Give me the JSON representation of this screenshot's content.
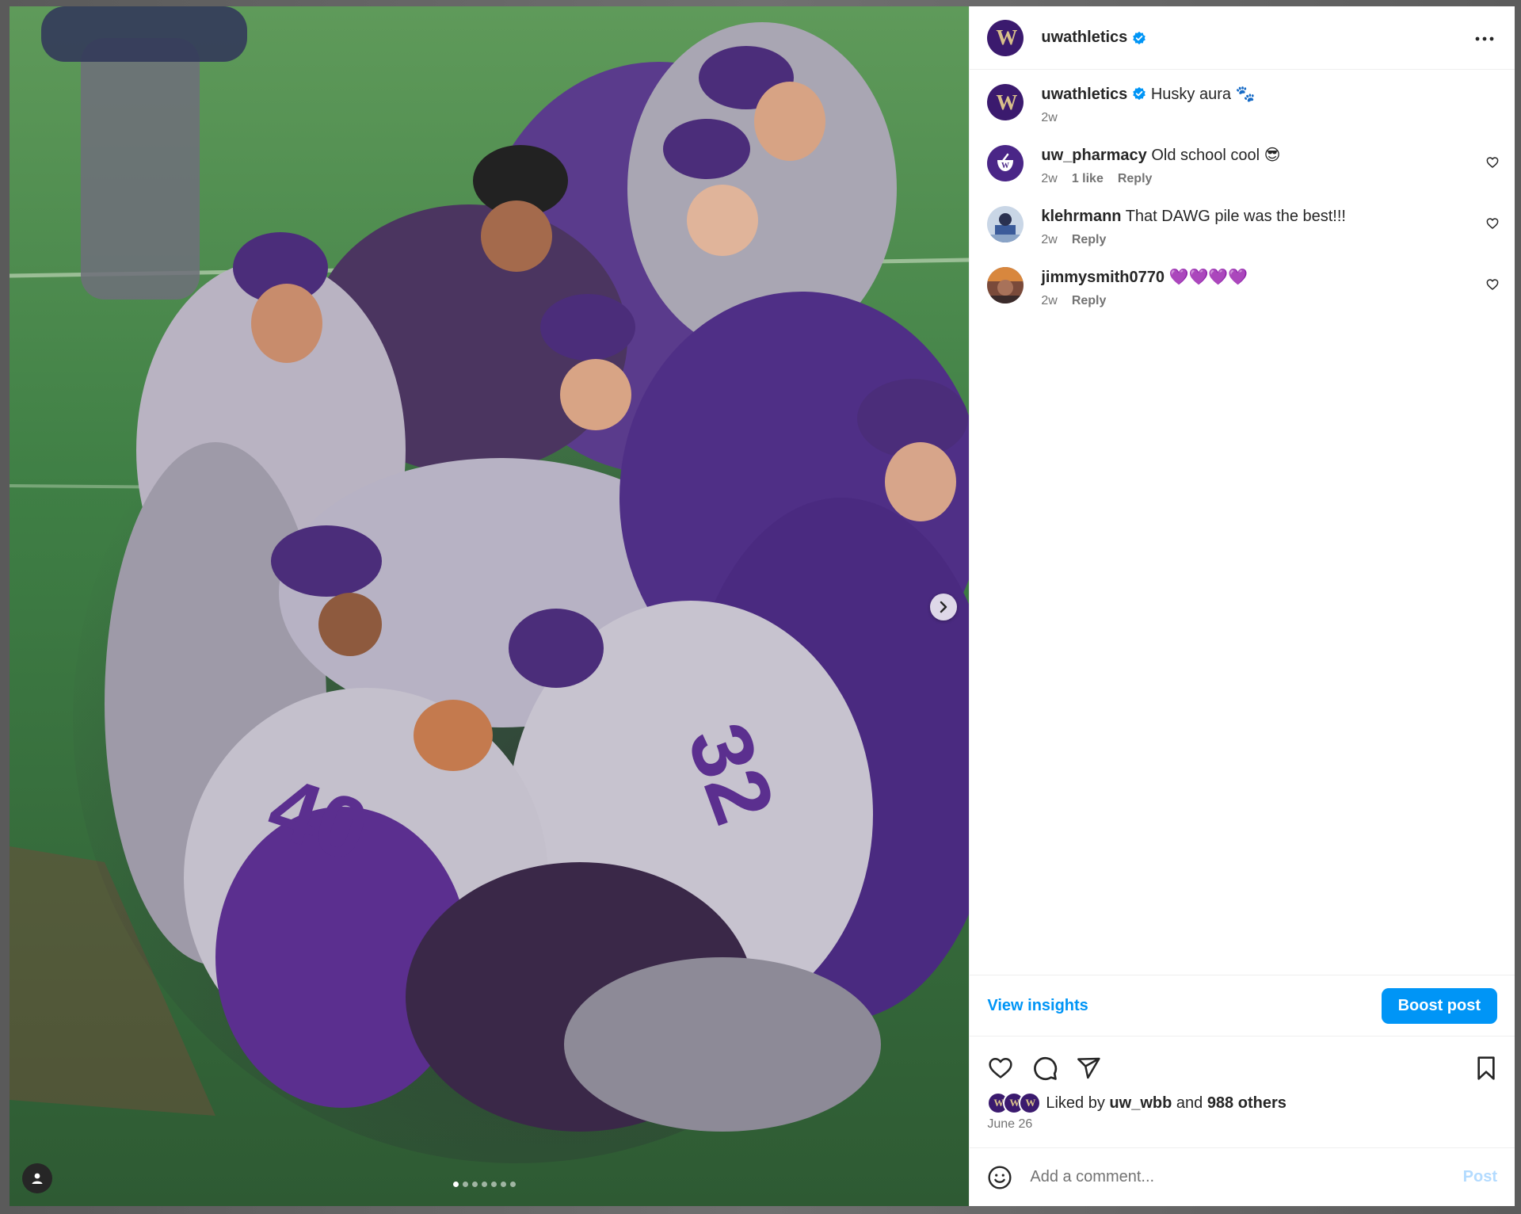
{
  "post": {
    "author": "uwathletics",
    "caption": "Husky aura 🐾",
    "caption_time": "2w",
    "carousel_count": 7,
    "carousel_active": 0
  },
  "comments": [
    {
      "user": "uw_pharmacy",
      "text": "Old school cool 😎",
      "time": "2w",
      "likes": "1 like",
      "reply": "Reply"
    },
    {
      "user": "klehrmann",
      "text": "That DAWG pile was the best!!!",
      "time": "2w",
      "likes": "",
      "reply": "Reply"
    },
    {
      "user": "jimmysmith0770",
      "text": "💜💜💜💜",
      "time": "2w",
      "likes": "",
      "reply": "Reply"
    }
  ],
  "insights": {
    "label": "View insights",
    "boost_label": "Boost post"
  },
  "likes": {
    "prefix": "Liked by",
    "first_user": "uw_wbb",
    "joiner": "and",
    "others": "988 others"
  },
  "date": "June 26",
  "add_comment": {
    "placeholder": "Add a comment...",
    "post_label": "Post"
  },
  "colors": {
    "accent": "#0095f6",
    "husky_purple": "#3b1a6e",
    "husky_gold": "#d9c08a"
  }
}
